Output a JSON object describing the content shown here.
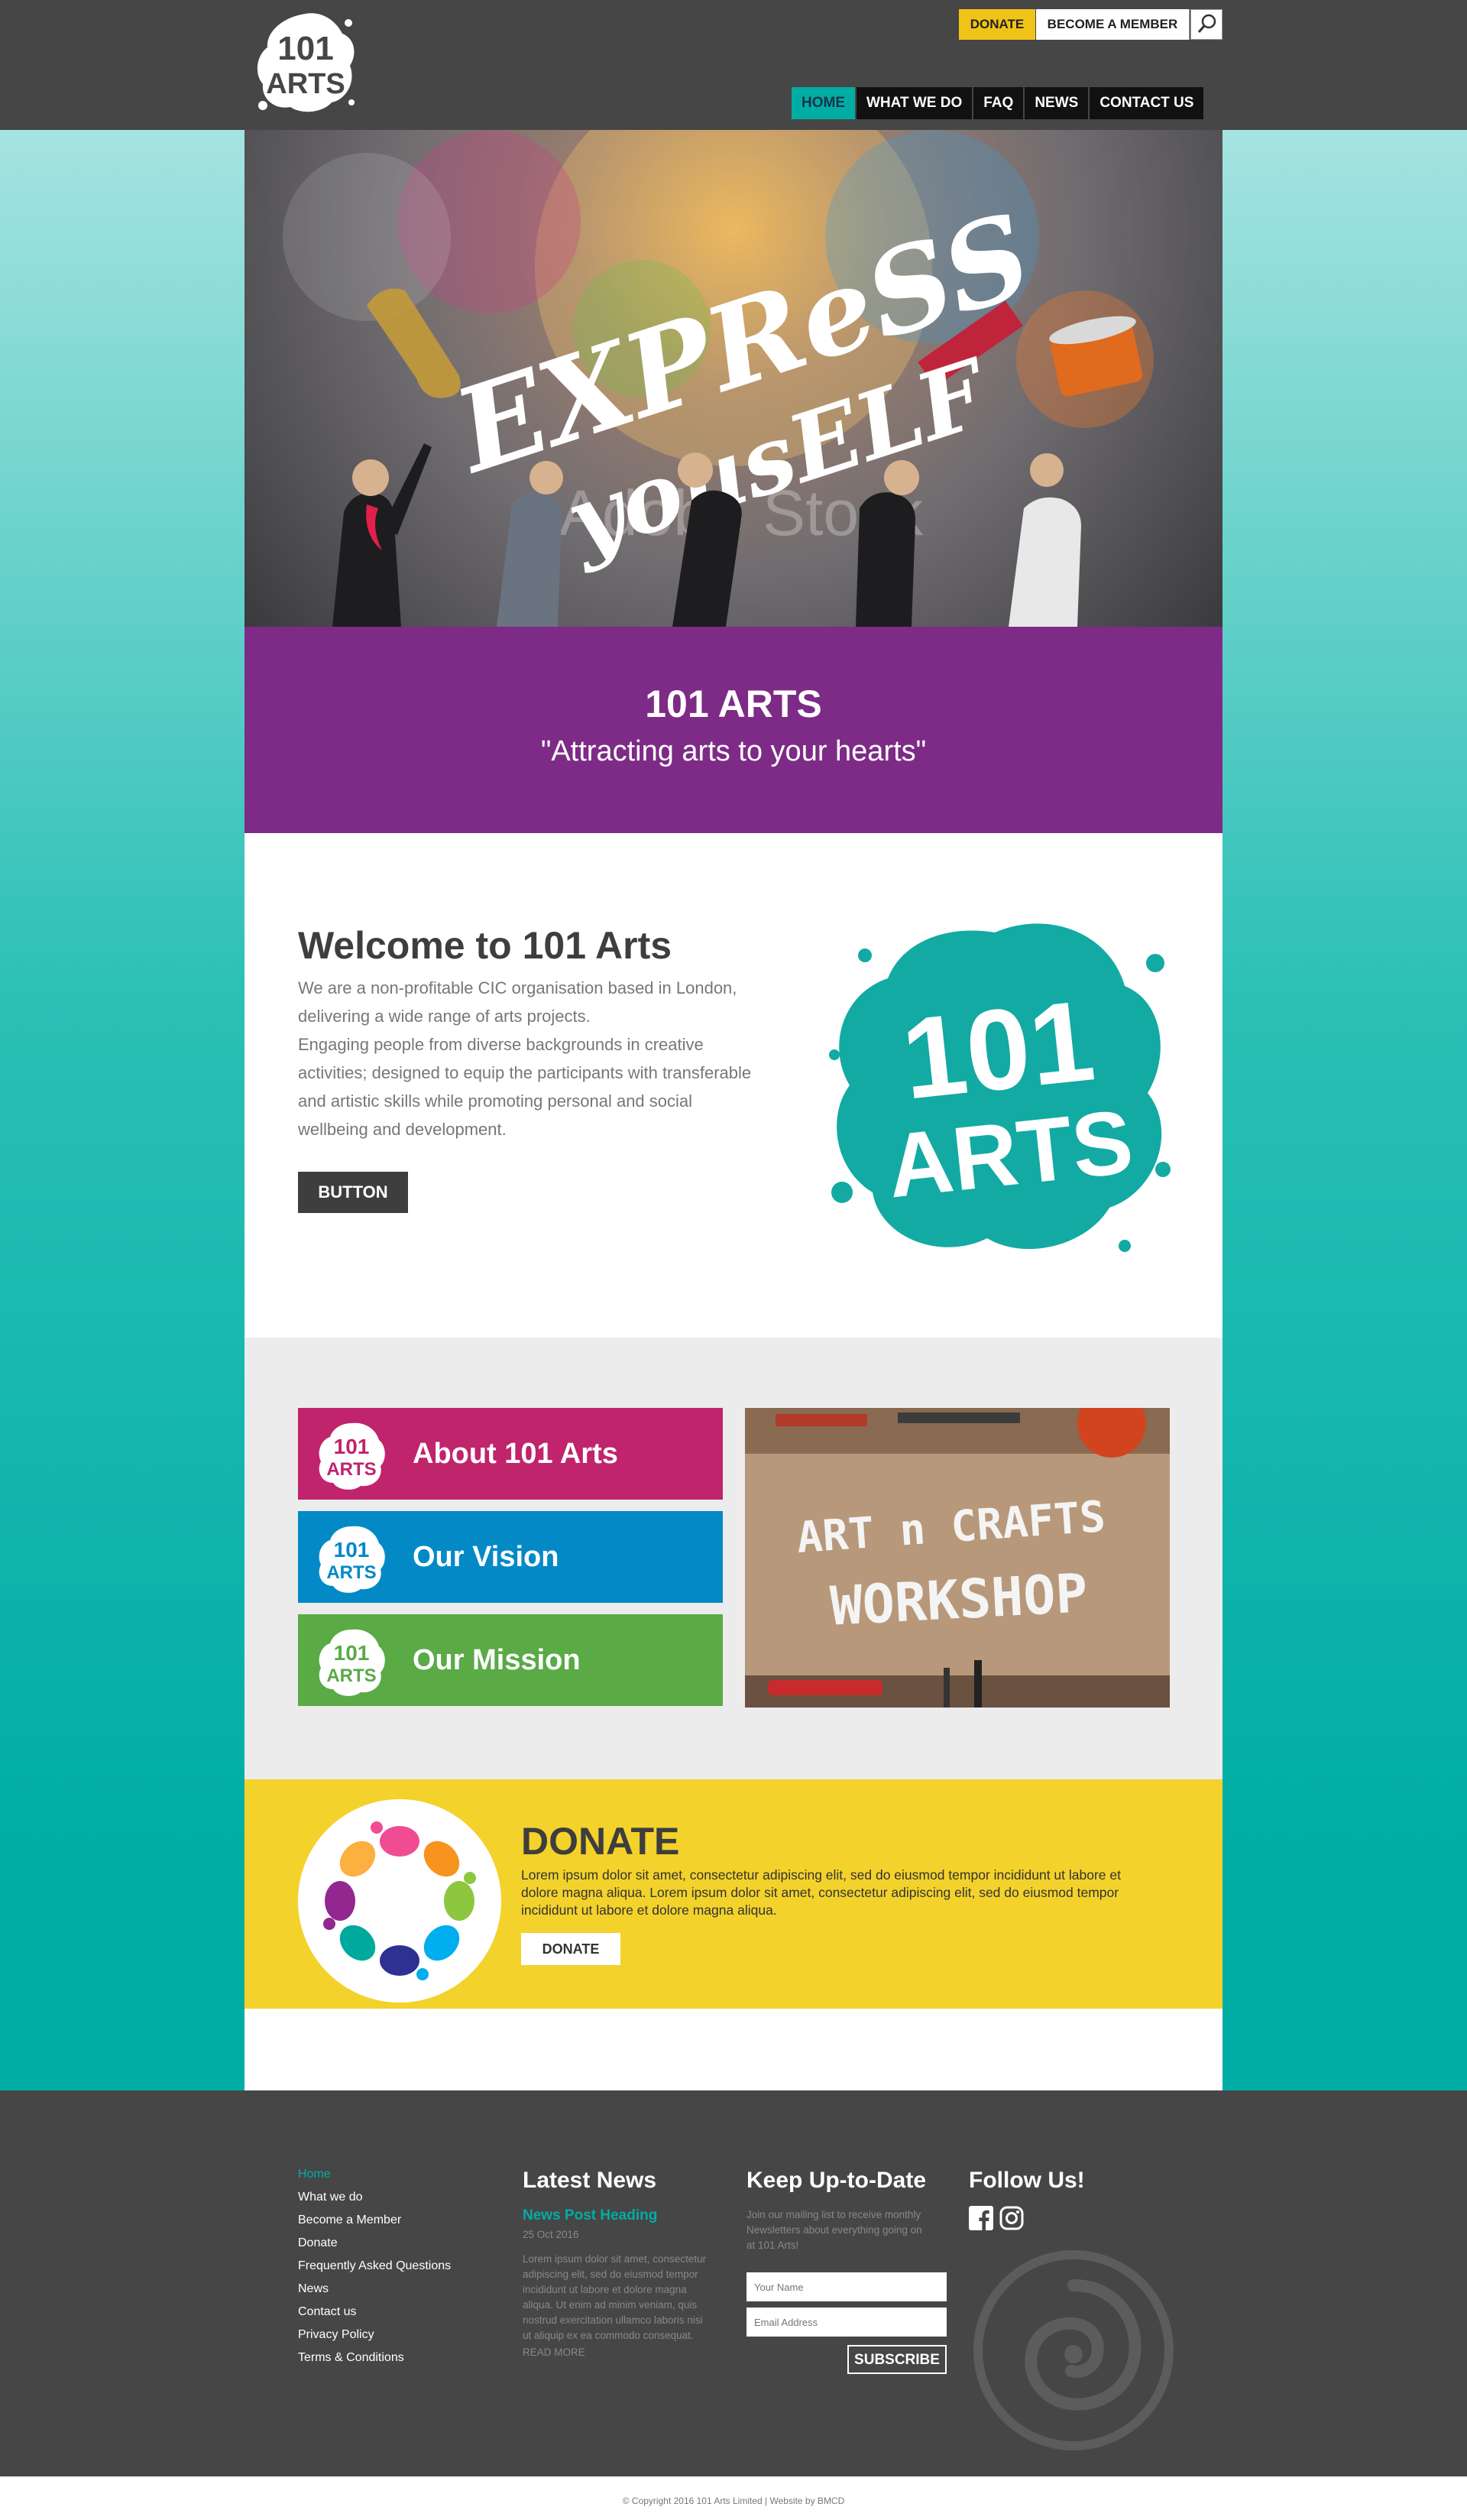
{
  "header": {
    "logo_text_top": "101",
    "logo_text_bottom": "ARTS",
    "donate_label": "DONATE",
    "member_label": "BECOME A MEMBER",
    "nav": [
      "HOME",
      "WHAT WE DO",
      "FAQ",
      "NEWS",
      "CONTACT US"
    ],
    "active_nav": "HOME"
  },
  "hero": {
    "headline_top": "EXPReSS",
    "headline_bottom": "yousELF",
    "watermark": "Adobe Stock"
  },
  "tagline": {
    "title": "101 ARTS",
    "subtitle": "\"Attracting arts to your hearts\""
  },
  "welcome": {
    "title": "Welcome to 101 Arts",
    "lines": [
      "We are a non-profitable CIC organisation based in London,",
      "delivering a wide range of arts projects.",
      "Engaging people from diverse backgrounds in creative",
      "activities; designed to equip the participants with transferable",
      "and artistic skills while promoting personal and social",
      "wellbeing and development."
    ],
    "button_label": "BUTTON",
    "logo_top": "101",
    "logo_bottom": "ARTS"
  },
  "cards": [
    {
      "label": "About 101 Arts",
      "color": "#c0246c"
    },
    {
      "label": "Our Vision",
      "color": "#0389c6"
    },
    {
      "label": "Our Mission",
      "color": "#5aaa46"
    }
  ],
  "workshop": {
    "line1": "ART n CRAFTS",
    "line2": "WORKSHOP"
  },
  "donate": {
    "title": "DONATE",
    "lines": [
      "Lorem ipsum dolor sit amet, consectetur adipiscing elit, sed do eiusmod tempor incididunt ut labore et",
      "dolore magna aliqua. Lorem ipsum dolor sit amet, consectetur adipiscing elit, sed do eiusmod tempor",
      "incididunt ut labore et dolore magna aliqua."
    ],
    "button_label": "DONATE"
  },
  "footer": {
    "links": [
      "Home",
      "What we do",
      "Become a Member",
      "Donate",
      "Frequently Asked Questions",
      "News",
      "Contact us",
      "Privacy Policy",
      "Terms & Conditions"
    ],
    "latest_news": {
      "heading": "Latest News",
      "post_heading": "News Post Heading",
      "date": "25 Oct 2016",
      "lines": [
        "Lorem ipsum dolor sit amet, consectetur",
        "adipiscing elit, sed do eiusmod tempor",
        "incididunt ut labore et dolore magna",
        "aliqua. Ut enim ad minim veniam, quis",
        "nostrud exercitation ullamco laboris nisi",
        "ut aliquip ex ea commodo consequat."
      ],
      "read_more": "READ MORE"
    },
    "keep_up": {
      "heading": "Keep Up-to-Date",
      "lines": [
        "Join our mailing list to receive monthly",
        "Newsletters about everything going on",
        "at 101 Arts!"
      ],
      "name_placeholder": "Your Name",
      "email_placeholder": "Email Address",
      "subscribe_label": "SUBSCRIBE"
    },
    "follow": {
      "heading": "Follow Us!",
      "icons": [
        "facebook-icon",
        "instagram-icon"
      ]
    },
    "copyright": "© Copyright 2016 101 Arts Limited  |  Website by BMCD"
  },
  "colors": {
    "teal": "#00ada5",
    "purple": "#7d2b87",
    "yellow": "#f3d22b",
    "dark": "#464646"
  }
}
